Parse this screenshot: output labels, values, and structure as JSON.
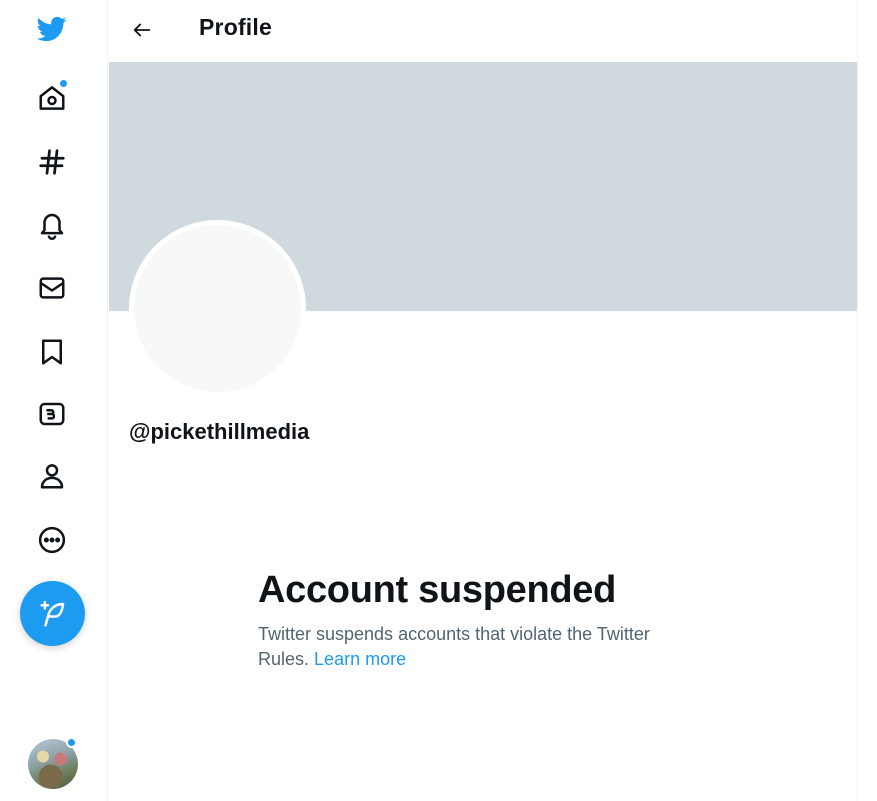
{
  "header": {
    "title": "Profile"
  },
  "nav": {
    "items": [
      {
        "name": "twitter-logo-icon"
      },
      {
        "name": "home-icon",
        "has_notification": true
      },
      {
        "name": "hashtag-icon"
      },
      {
        "name": "bell-icon"
      },
      {
        "name": "mail-icon"
      },
      {
        "name": "bookmark-icon"
      },
      {
        "name": "twitter-blue-icon"
      },
      {
        "name": "profile-icon"
      },
      {
        "name": "more-icon"
      }
    ],
    "compose_icon": "feather-plus-icon"
  },
  "profile": {
    "handle": "@pickethillmedia"
  },
  "notice": {
    "heading": "Account suspended",
    "body": "Twitter suspends accounts that violate the Twitter Rules.",
    "link": "Learn more"
  },
  "colors": {
    "accent": "#1d9bf0",
    "banner": "#cfd9de",
    "text": "#0f1419",
    "muted": "#536471"
  }
}
